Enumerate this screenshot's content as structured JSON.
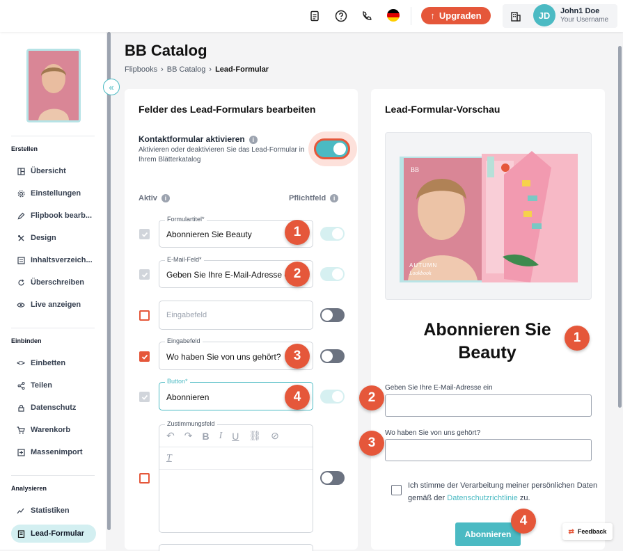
{
  "topbar": {
    "upgrade_label": "Upgraden",
    "user_initials": "JD",
    "user_name": "John1 Doe",
    "user_sub": "Your Username"
  },
  "sidebar": {
    "section_create": "Erstellen",
    "create_items": [
      {
        "label": "Übersicht",
        "icon": "layout-icon"
      },
      {
        "label": "Einstellungen",
        "icon": "gear-icon"
      },
      {
        "label": "Flipbook bearb...",
        "icon": "pencil-icon"
      },
      {
        "label": "Design",
        "icon": "design-icon"
      },
      {
        "label": "Inhaltsverzeich...",
        "icon": "list-icon"
      },
      {
        "label": "Überschreiben",
        "icon": "refresh-icon"
      },
      {
        "label": "Live anzeigen",
        "icon": "eye-icon"
      }
    ],
    "section_embed": "Einbinden",
    "embed_items": [
      {
        "label": "Einbetten",
        "icon": "code-icon"
      },
      {
        "label": "Teilen",
        "icon": "share-icon"
      },
      {
        "label": "Datenschutz",
        "icon": "lock-icon"
      },
      {
        "label": "Warenkorb",
        "icon": "cart-icon"
      },
      {
        "label": "Massenimport",
        "icon": "import-icon"
      }
    ],
    "section_analyze": "Analysieren",
    "analyze_items": [
      {
        "label": "Statistiken",
        "icon": "chart-icon"
      },
      {
        "label": "Lead-Formular",
        "icon": "form-icon"
      }
    ]
  },
  "page": {
    "title": "BB Catalog",
    "breadcrumbs": [
      "Flipbooks",
      "BB Catalog",
      "Lead-Formular"
    ]
  },
  "editor": {
    "title": "Felder des Lead-Formulars bearbeiten",
    "toggle_label": "Kontaktformular aktivieren",
    "toggle_desc": "Aktivieren oder deaktivieren Sie das Lead-Formular in Ihrem Blätterkatalog",
    "toggle_on": true,
    "col_active": "Aktiv",
    "col_required": "Pflichtfeld",
    "fields": [
      {
        "label": "Formulartitel*",
        "value": "Abonnieren Sie Beauty",
        "active": true,
        "required": true,
        "badge": "1"
      },
      {
        "label": "E-Mail-Feld*",
        "value": "Geben Sie Ihre E-Mail-Adresse ein",
        "active": true,
        "required": true,
        "badge": "2"
      },
      {
        "placeholder": "Eingabefeld",
        "active": false,
        "required": false
      },
      {
        "label": "Eingabefeld",
        "value": "Wo haben Sie von uns gehört?",
        "active": true,
        "required": false,
        "badge": "3"
      },
      {
        "label": "Button*",
        "value": "Abonnieren",
        "active": true,
        "required": true,
        "badge": "4"
      },
      {
        "label": "Zustimmungsfeld",
        "active": false,
        "required": false
      }
    ]
  },
  "preview": {
    "title": "Lead-Formular-Vorschau",
    "form_title": "Abonnieren Sie Beauty",
    "email_label": "Geben Sie Ihre E-Mail-Adresse ein",
    "question_label": "Wo haben Sie von uns gehört?",
    "consent_prefix": "Ich stimme der Verarbeitung meiner persönlichen Daten gemäß der",
    "consent_link": "Datenschutzrichtlinie",
    "consent_suffix": "zu.",
    "button_label": "Abonnieren",
    "cover_text_1": "AUTUMN",
    "cover_text_2": "Lookbook",
    "cover_logo": "BB",
    "badges": [
      "1",
      "2",
      "3",
      "4"
    ]
  },
  "feedback_label": "Feedback",
  "colors": {
    "accent": "#4bbac3",
    "brand": "#e5573a"
  }
}
